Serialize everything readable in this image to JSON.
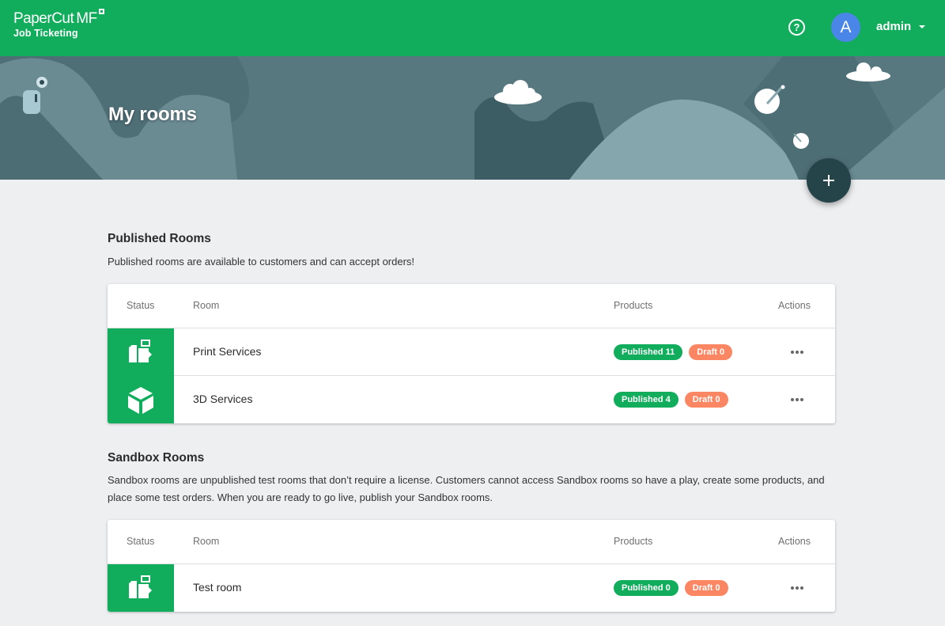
{
  "header": {
    "brand_name": "PaperCut",
    "brand_suffix": "MF",
    "product_name": "Job Ticketing",
    "help_icon_glyph": "?",
    "avatar_initial": "A",
    "username": "admin"
  },
  "banner": {
    "title": "My rooms",
    "add_button_icon": "plus-icon"
  },
  "colors": {
    "brand_green": "#12ad5c",
    "draft_orange": "#fa8663",
    "avatar_blue": "#4a86e8",
    "fab_dark": "#24444a"
  },
  "published_section": {
    "title": "Published Rooms",
    "description": "Published rooms are available to customers and can accept orders!",
    "columns": [
      "Status",
      "Room",
      "Products",
      "Actions"
    ],
    "rows": [
      {
        "icon": "print-services-icon",
        "name": "Print Services",
        "published_label": "Published 11",
        "draft_label": "Draft 0"
      },
      {
        "icon": "cube-3d-icon",
        "name": "3D Services",
        "published_label": "Published 4",
        "draft_label": "Draft 0"
      }
    ]
  },
  "sandbox_section": {
    "title": "Sandbox Rooms",
    "description": "Sandbox rooms are unpublished test rooms that don’t require a license. Customers cannot access Sandbox rooms so have a play, create some products, and place some test orders. When you are ready to go live, publish your Sandbox rooms.",
    "columns": [
      "Status",
      "Room",
      "Products",
      "Actions"
    ],
    "rows": [
      {
        "icon": "print-services-icon",
        "name": "Test room",
        "published_label": "Published 0",
        "draft_label": "Draft 0"
      }
    ]
  }
}
